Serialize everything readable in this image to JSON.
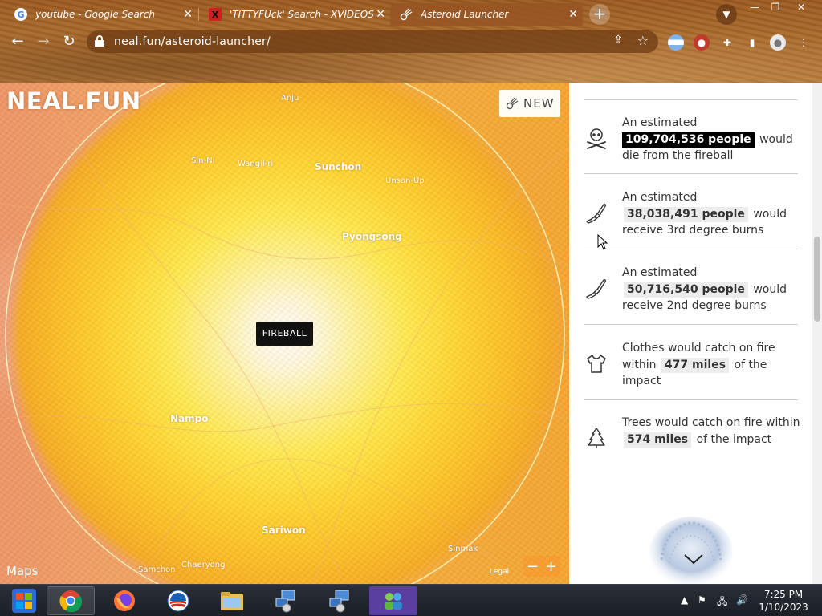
{
  "browser": {
    "tabs": [
      {
        "title": "youtube - Google Search",
        "icon": "google-g-icon"
      },
      {
        "title": "'TITTYFUck' Search - XVIDEOS",
        "icon": "x-brand-icon"
      },
      {
        "title": "Asteroid Launcher",
        "icon": "asteroid-icon"
      }
    ],
    "new_tab": "+",
    "close": "✕",
    "url": "neal.fun/asteroid-launcher/",
    "window": {
      "minimize": "—",
      "restore": "❐",
      "close": "✕"
    }
  },
  "map": {
    "logo": "NEAL.FUN",
    "new_button": "NEW",
    "fireball_label": "FIREBALL",
    "attribution": "Maps",
    "legal": "Legal",
    "zoom": {
      "out": "−",
      "in": "+"
    },
    "places": [
      {
        "name": "Sin-Ni"
      },
      {
        "name": "Wangil-ri"
      },
      {
        "name": "Sunchon"
      },
      {
        "name": "Unsan-Up"
      },
      {
        "name": "Pyongsong"
      },
      {
        "name": "Nampo"
      },
      {
        "name": "Sariwon"
      },
      {
        "name": "Chaeryong"
      },
      {
        "name": "Sinmak"
      },
      {
        "name": "Anju"
      },
      {
        "name": "Samchon"
      }
    ]
  },
  "panel": {
    "stats": [
      {
        "prefix": "An estimated",
        "value": "109,704,536 people",
        "suffix": "would die from the fireball",
        "icon": "skull-crossbones-icon"
      },
      {
        "prefix": "An estimated",
        "value": "38,038,491 people",
        "suffix": "would receive 3rd degree burns",
        "icon": "burned-arm-icon"
      },
      {
        "prefix": "An estimated",
        "value": "50,716,540 people",
        "suffix": "would receive 2nd degree burns",
        "icon": "burned-arm-icon"
      },
      {
        "prefix": "Clothes would catch on fire within",
        "value": "477 miles",
        "suffix": "of the impact",
        "icon": "shirt-icon"
      },
      {
        "prefix": "Trees would catch on fire within",
        "value": "574 miles",
        "suffix": "of the impact",
        "icon": "pine-tree-icon"
      }
    ]
  },
  "taskbar": {
    "time": "7:25 PM",
    "date": "1/10/2023"
  }
}
